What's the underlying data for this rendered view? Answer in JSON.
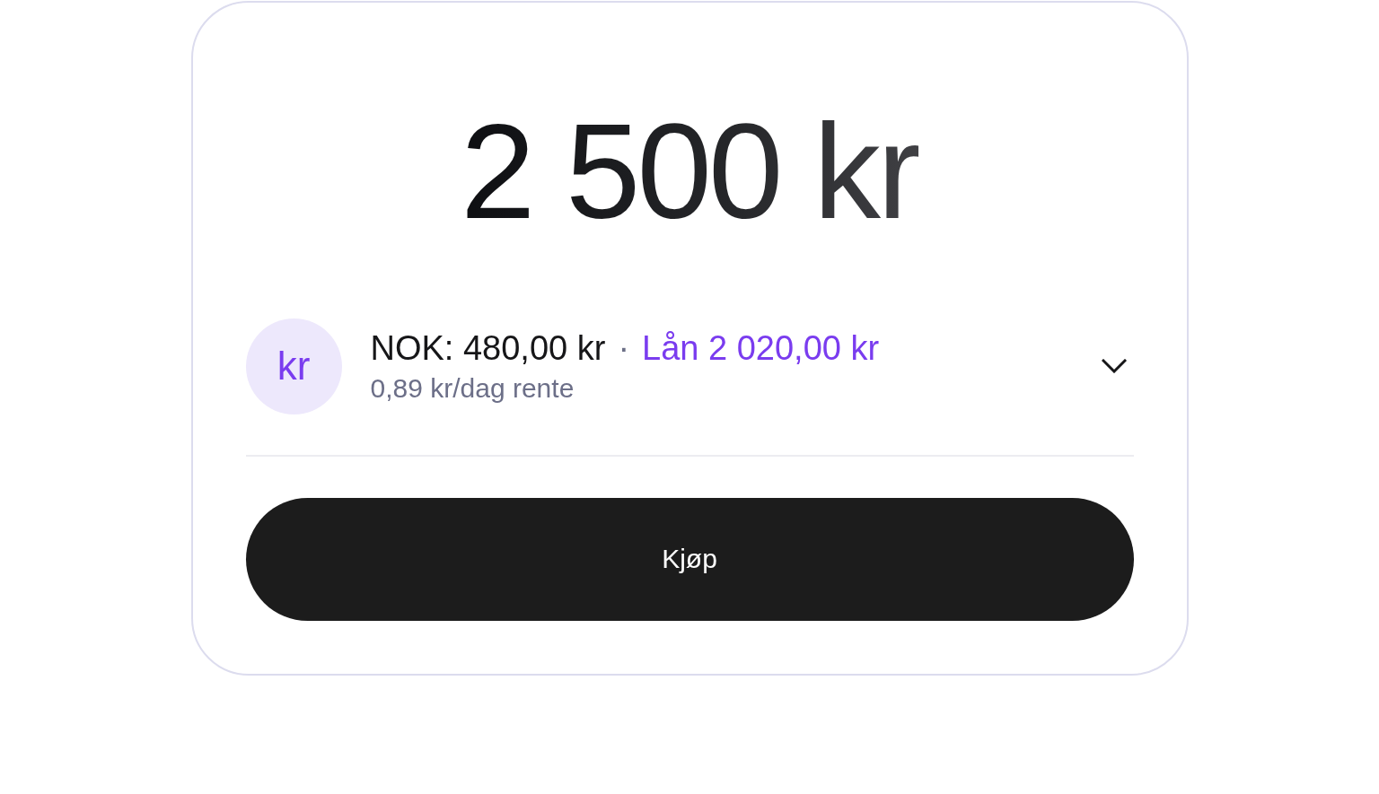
{
  "amount": "2 500 kr",
  "account": {
    "avatar": "kr",
    "balance": "NOK: 480,00 kr",
    "separator": "·",
    "loan": "Lån 2 020,00 kr",
    "detail": "0,89 kr/dag rente",
    "expanded": false
  },
  "buy_button": {
    "label": "Kjøp"
  }
}
